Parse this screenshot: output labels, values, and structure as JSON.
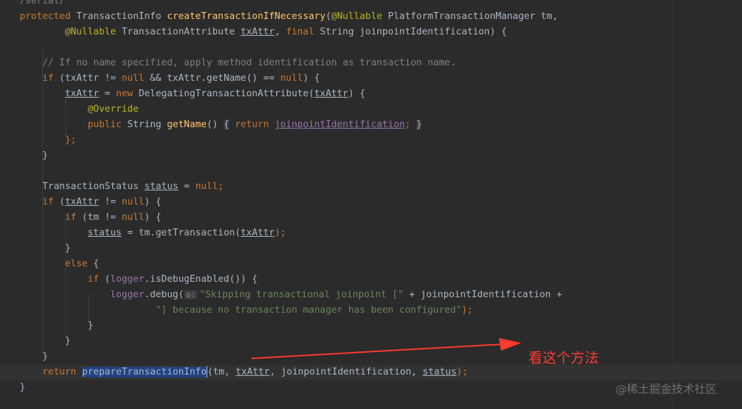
{
  "editor": {
    "lines": [
      {
        "tokens": [
          {
            "t": "/serial/",
            "c": "cm"
          }
        ]
      },
      {
        "tokens": [
          {
            "t": "protected ",
            "c": "kw"
          },
          {
            "t": "TransactionInfo "
          },
          {
            "t": "createTransactionIfNecessary",
            "c": "fn"
          },
          {
            "t": "("
          },
          {
            "t": "@Nullable",
            "c": "ann"
          },
          {
            "t": " PlatformTransactionManager tm,"
          }
        ]
      },
      {
        "tokens": [
          {
            "t": "        "
          },
          {
            "t": "@Nullable",
            "c": "ann"
          },
          {
            "t": " TransactionAttribute "
          },
          {
            "t": "txAttr",
            "c": "ul"
          },
          {
            "t": ", "
          },
          {
            "t": "final ",
            "c": "kw"
          },
          {
            "t": "String joinpointIdentification) {"
          }
        ]
      },
      {
        "tokens": []
      },
      {
        "tokens": [
          {
            "t": "    "
          },
          {
            "t": "// If no name specified, apply method identification as transaction name.",
            "c": "cm"
          }
        ]
      },
      {
        "tokens": [
          {
            "t": "    "
          },
          {
            "t": "if",
            "c": "kw"
          },
          {
            "t": " (txAttr != "
          },
          {
            "t": "null",
            "c": "kw"
          },
          {
            "t": " && txAttr.getName() == "
          },
          {
            "t": "null",
            "c": "kw"
          },
          {
            "t": ") {"
          }
        ]
      },
      {
        "tokens": [
          {
            "t": "        "
          },
          {
            "t": "txAttr",
            "c": "ul"
          },
          {
            "t": " = "
          },
          {
            "t": "new ",
            "c": "kw"
          },
          {
            "t": "DelegatingTransactionAttribute("
          },
          {
            "t": "txAttr",
            "c": "ul"
          },
          {
            "t": ") {"
          }
        ]
      },
      {
        "tokens": [
          {
            "t": "            "
          },
          {
            "t": "@Override",
            "c": "ann"
          }
        ]
      },
      {
        "tokens": [
          {
            "t": "            "
          },
          {
            "t": "public ",
            "c": "kw"
          },
          {
            "t": "String "
          },
          {
            "t": "getName",
            "c": "fn"
          },
          {
            "t": "() "
          },
          {
            "t": "{",
            "c": "fold"
          },
          {
            "t": " "
          },
          {
            "t": "return ",
            "c": "kw"
          },
          {
            "t": "joinpointIdentification",
            "c": "fld ul"
          },
          {
            "t": ";",
            "c": "kw"
          },
          {
            "t": " "
          },
          {
            "t": "}",
            "c": "fold"
          }
        ]
      },
      {
        "tokens": [
          {
            "t": "        "
          },
          {
            "t": "};",
            "c": "kw"
          }
        ]
      },
      {
        "tokens": [
          {
            "t": "    }"
          }
        ]
      },
      {
        "tokens": []
      },
      {
        "tokens": [
          {
            "t": "    TransactionStatus "
          },
          {
            "t": "status",
            "c": "ul"
          },
          {
            "t": " = "
          },
          {
            "t": "null",
            "c": "kw"
          },
          {
            "t": ";",
            "c": "kw"
          }
        ]
      },
      {
        "tokens": [
          {
            "t": "    "
          },
          {
            "t": "if",
            "c": "kw"
          },
          {
            "t": " ("
          },
          {
            "t": "txAttr",
            "c": "ul"
          },
          {
            "t": " != "
          },
          {
            "t": "null",
            "c": "kw"
          },
          {
            "t": ") {"
          }
        ]
      },
      {
        "tokens": [
          {
            "t": "        "
          },
          {
            "t": "if",
            "c": "kw"
          },
          {
            "t": " (tm != "
          },
          {
            "t": "null",
            "c": "kw"
          },
          {
            "t": ") {"
          }
        ]
      },
      {
        "tokens": [
          {
            "t": "            "
          },
          {
            "t": "status",
            "c": "ul"
          },
          {
            "t": " = tm.getTransaction("
          },
          {
            "t": "txAttr",
            "c": "ul"
          },
          {
            "t": ");",
            "c": "kw"
          }
        ]
      },
      {
        "tokens": [
          {
            "t": "        }"
          }
        ]
      },
      {
        "tokens": [
          {
            "t": "        "
          },
          {
            "t": "else",
            "c": "kw"
          },
          {
            "t": " {"
          }
        ]
      },
      {
        "tokens": [
          {
            "t": "            "
          },
          {
            "t": "if",
            "c": "kw"
          },
          {
            "t": " ("
          },
          {
            "t": "logger",
            "c": "fld"
          },
          {
            "t": ".isDebugEnabled()) {"
          }
        ]
      },
      {
        "tokens": [
          {
            "t": "                "
          },
          {
            "t": "logger",
            "c": "fld"
          },
          {
            "t": ".debug("
          },
          {
            "t": "o:",
            "c": "hint"
          },
          {
            "t": "\"Skipping transactional joinpoint [\"",
            "c": "str"
          },
          {
            "t": " + joinpointIdentification +"
          }
        ]
      },
      {
        "tokens": [
          {
            "t": "                        "
          },
          {
            "t": "\"] because no transaction manager has been configured\"",
            "c": "str"
          },
          {
            "t": ");",
            "c": "kw"
          }
        ]
      },
      {
        "tokens": [
          {
            "t": "            }"
          }
        ]
      },
      {
        "tokens": [
          {
            "t": "        }"
          }
        ]
      },
      {
        "tokens": [
          {
            "t": "    }"
          }
        ]
      },
      {
        "tokens": [
          {
            "t": "    "
          },
          {
            "t": "return ",
            "c": "kw"
          },
          {
            "t": "prepareTransactionInfo",
            "c": "sel"
          },
          {
            "t": "",
            "c": "caret"
          },
          {
            "t": "(tm, "
          },
          {
            "t": "txAttr",
            "c": "ul"
          },
          {
            "t": ", joinpointIdentification, "
          },
          {
            "t": "status",
            "c": "ul"
          },
          {
            "t": ");",
            "c": "kw"
          }
        ]
      },
      {
        "tokens": [
          {
            "t": "}"
          }
        ]
      }
    ]
  },
  "annotation": {
    "note": "看这个方法",
    "color": "#ff3b2f"
  },
  "watermark": "@稀土掘金技术社区",
  "colors": {
    "background": "#2b2b2b",
    "keyword": "#cc7832",
    "method": "#ffc66d",
    "annotation": "#bbb529",
    "comment": "#808080",
    "string": "#6a8759",
    "field": "#9876aa",
    "selection": "#214283"
  }
}
